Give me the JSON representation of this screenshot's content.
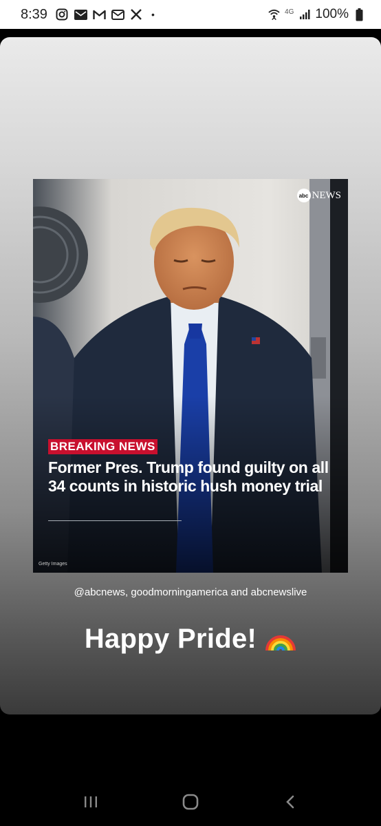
{
  "status_bar": {
    "time": "8:39",
    "left_icons": [
      "instagram-icon",
      "mail-icon",
      "gmail-icon",
      "mail-icon",
      "x-icon"
    ],
    "dot": "•",
    "network": "4G",
    "battery": "100%"
  },
  "post": {
    "logo_circle": "abc",
    "logo_text": "NEWS",
    "tag": "BREAKING NEWS",
    "headline": "Former Pres. Trump found guilty on all 34 counts in historic hush money trial",
    "credit": "Getty Images"
  },
  "story": {
    "mentions": "@abcnews, goodmorningamerica and abcnewslive",
    "caption": "Happy Pride!"
  },
  "colors": {
    "breaking": "#c8102e",
    "tie": "#1a3fa8",
    "suit": "#1f2a3d"
  },
  "nav": {
    "icons": [
      "recent-apps-icon",
      "home-icon",
      "back-icon"
    ]
  }
}
